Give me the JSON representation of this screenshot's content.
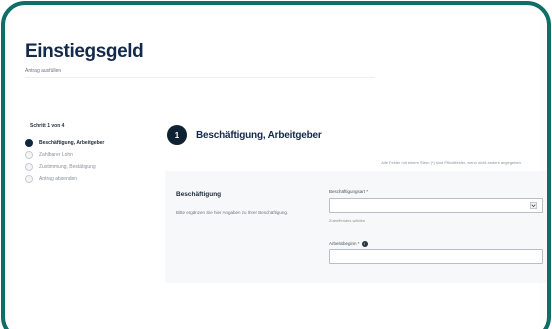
{
  "app": {
    "title": "Einstiegsgeld",
    "subtitle": "Antrag ausfüllen"
  },
  "sidebar": {
    "step_counter": "Schritt 1 von 4",
    "steps": [
      {
        "label": "Beschäftigung, Arbeitgeber",
        "active": true
      },
      {
        "label": "Zahlbarer Lohn",
        "active": false
      },
      {
        "label": "Zustimmung, Bestätigung",
        "active": false
      },
      {
        "label": "Antrag absenden",
        "active": false
      }
    ]
  },
  "step": {
    "number": "1",
    "title": "Beschäftigung, Arbeitgeber",
    "required_note": "Alle Felder mit einem Stern (*) sind Pflichtfelder, wenn nicht anders angegeben."
  },
  "section": {
    "heading": "Beschäftigung",
    "description": "Bitte ergänzen Sie hier Angaben zu Ihrer Beschäftigung."
  },
  "form": {
    "employment_type": {
      "label": "Beschäftigungsart *",
      "value": "",
      "hint": "Zutreffendes wählen"
    },
    "start_date": {
      "label": "Arbeitsbeginn *",
      "value": ""
    }
  },
  "colors": {
    "frame": "#0f6e66",
    "active_step": "#0f2740",
    "card_background": "#f7f8f9"
  }
}
